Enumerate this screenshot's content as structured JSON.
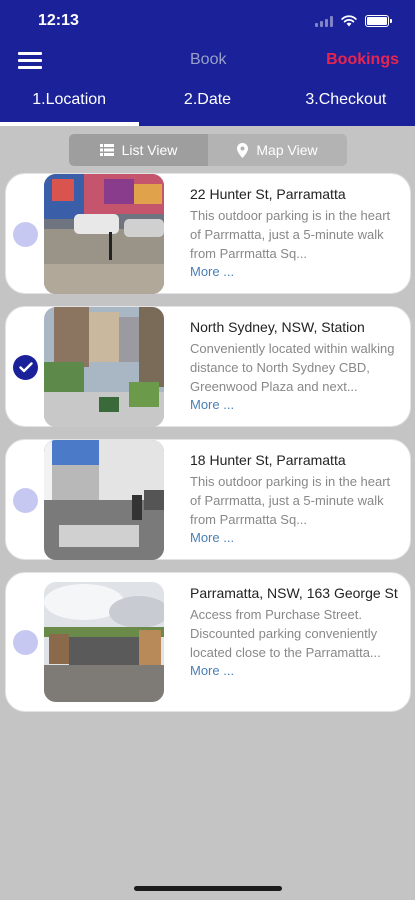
{
  "status_bar": {
    "time": "12:13"
  },
  "header": {
    "book_label": "Book",
    "bookings_label": "Bookings"
  },
  "steps": [
    {
      "label": "1.Location"
    },
    {
      "label": "2.Date"
    },
    {
      "label": "3.Checkout"
    }
  ],
  "toggle": {
    "list_label": "List View",
    "map_label": "Map View"
  },
  "listings": [
    {
      "title": "22 Hunter St, Parramatta",
      "description": "This outdoor parking is in the heart of Parrmatta, just a 5-minute walk from Parrmatta Sq...",
      "more": "More ...",
      "selected": false
    },
    {
      "title": "North Sydney, NSW, Station",
      "description": "Conveniently located within walking distance to North Sydney CBD, Greenwood Plaza and next...",
      "more": "More ...",
      "selected": true
    },
    {
      "title": "18 Hunter St, Parramatta",
      "description": "This outdoor parking is in the heart of Parrmatta, just a 5-minute walk from Parrmatta Sq...",
      "more": "More ...",
      "selected": false
    },
    {
      "title": "Parramatta, NSW, 163 George St",
      "description": "Access from Purchase Street. Discounted parking conveniently located close to the Parramatta...",
      "more": "More ...",
      "selected": false
    }
  ],
  "colors": {
    "primary": "#1a2199",
    "accent": "#e8254f",
    "link": "#4a7fb5",
    "radio_unselected": "#c6c8f2"
  }
}
